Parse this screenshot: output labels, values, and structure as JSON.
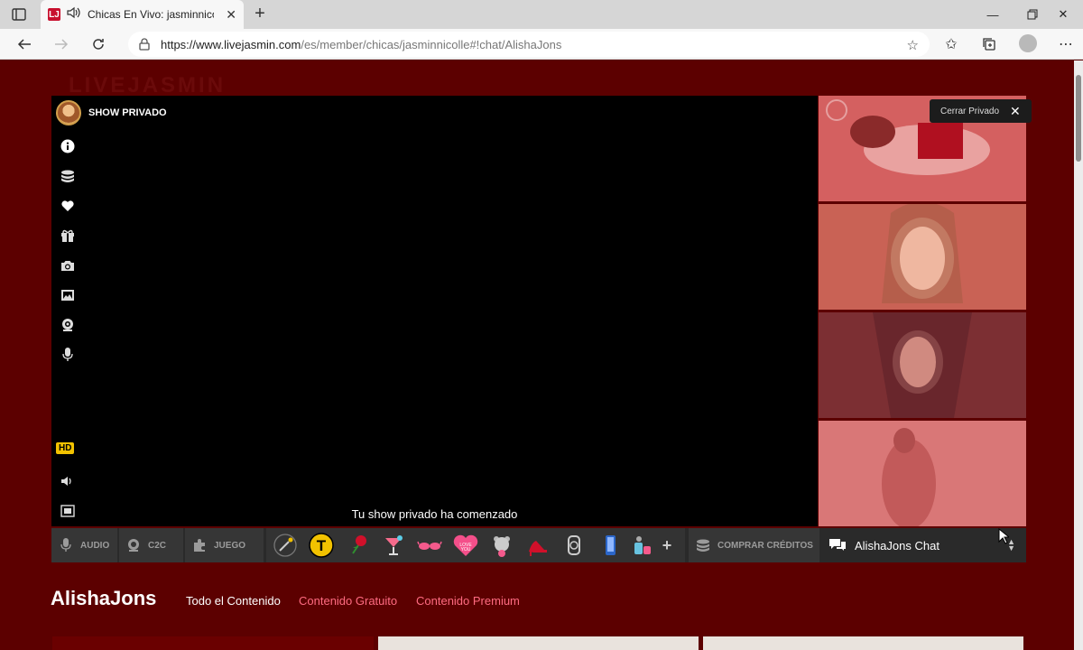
{
  "browser": {
    "tab_title": "Chicas En Vivo: jasminnicolle",
    "url_host": "https://www.livejasmin.com",
    "url_path": "/es/member/chicas/jasminnicolle#!chat/AlishaJons"
  },
  "player": {
    "show_title": "SHOW PRIVADO",
    "hd_label": "HD",
    "message": "Tu show privado ha comenzado",
    "close_label": "Cerrar Privado"
  },
  "toolbar": {
    "audio_label": "AUDIO",
    "c2c_label": "C2C",
    "game_label": "JUEGO",
    "buy_credits_label": "COMPRAR CRÉDITOS",
    "chat_label": "AlishaJons Chat"
  },
  "profile": {
    "name": "AlishaJons",
    "tabs": [
      {
        "label": "Todo el Contenido"
      },
      {
        "label": "Contenido Gratuito"
      },
      {
        "label": "Contenido Premium"
      }
    ]
  },
  "colors": {
    "page_bg": "#5c0000",
    "accent_pink": "#ff6b81",
    "hd_yellow": "#f2c200"
  },
  "icons": {
    "side": [
      "info-icon",
      "coins-icon",
      "heart-icon",
      "gift-icon",
      "camera-icon",
      "gallery-icon",
      "webcam-icon",
      "microphone-icon",
      "volume-icon",
      "fullscreen-icon"
    ],
    "gifts": [
      "magic-wand-icon",
      "tip-token-icon",
      "rose-icon",
      "cocktail-icon",
      "sunglasses-icon",
      "love-heart-icon",
      "teddy-icon",
      "high-heel-icon",
      "watch-icon",
      "phone-icon",
      "perfume-icon",
      "more-plus-icon"
    ]
  }
}
